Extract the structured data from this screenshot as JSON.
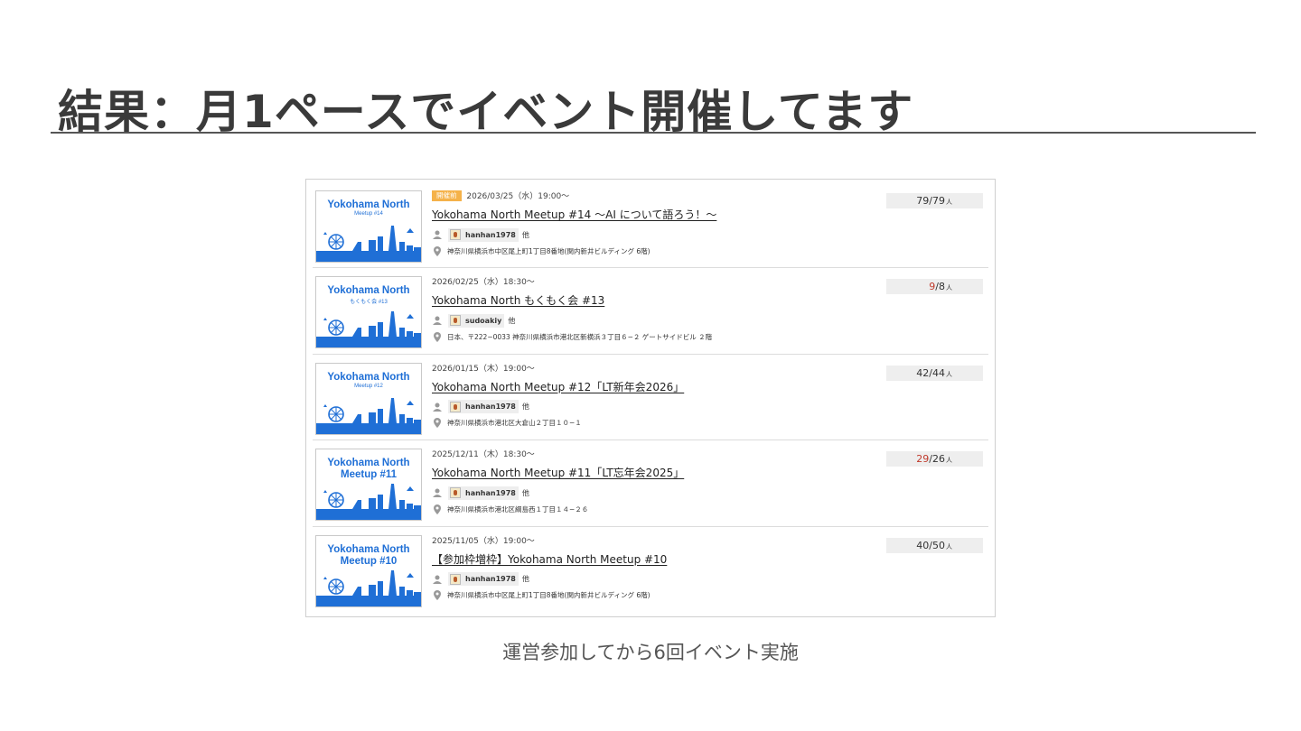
{
  "slide": {
    "title": "結果：月1ペースでイベント開催してます",
    "caption": "運営参加してから6回イベント実施"
  },
  "colors": {
    "brand_blue": "#1f6fd6",
    "badge": "#f5b24a",
    "over_capacity": "#c0392b"
  },
  "events": [
    {
      "thumb_title": "Yokohama North",
      "thumb_sub": "Meetup #14",
      "badge": "開催前",
      "date": "2026/03/25（水）19:00〜",
      "title": "Yokohama North Meetup #14 〜AI について語ろう！〜",
      "owner": "hanhan1978",
      "owner_suffix": "他",
      "place": "神奈川県横浜市中区尾上町1丁目8番地(関内新井ビルディング 6階)",
      "count_main": "79",
      "count_rest": "/79",
      "count_unit": "人",
      "over": false
    },
    {
      "thumb_title": "Yokohama North",
      "thumb_sub": "もくもく会 #13",
      "badge": "",
      "date": "2026/02/25（水）18:30〜",
      "title": "Yokohama North もくもく会 #13",
      "owner": "sudoakiy",
      "owner_suffix": "他",
      "place": "日本、〒222−0033 神奈川県横浜市港北区新横浜３丁目６−２ ゲートサイドビル ２階",
      "count_main": "9",
      "count_rest": "/8",
      "count_unit": "人",
      "over": true
    },
    {
      "thumb_title": "Yokohama North",
      "thumb_sub": "Meetup #12",
      "badge": "",
      "date": "2026/01/15（木）19:00〜",
      "title": "Yokohama North Meetup #12「LT新年会2026」",
      "owner": "hanhan1978",
      "owner_suffix": "他",
      "place": "神奈川県横浜市港北区大倉山２丁目１０−１",
      "count_main": "42",
      "count_rest": "/44",
      "count_unit": "人",
      "over": false
    },
    {
      "thumb_title": "Yokohama North",
      "thumb_sub": "Meetup #11",
      "badge": "",
      "date": "2025/12/11（木）18:30〜",
      "title": "Yokohama North Meetup #11「LT忘年会2025」",
      "owner": "hanhan1978",
      "owner_suffix": "他",
      "place": "神奈川県横浜市港北区綱島西１丁目１４−２６",
      "count_main": "29",
      "count_rest": "/26",
      "count_unit": "人",
      "over": true
    },
    {
      "thumb_title": "Yokohama North",
      "thumb_sub": "Meetup #10",
      "badge": "",
      "date": "2025/11/05（水）19:00〜",
      "title": "【参加枠増枠】Yokohama North Meetup #10",
      "owner": "hanhan1978",
      "owner_suffix": "他",
      "place": "神奈川県横浜市中区尾上町1丁目8番地(関内新井ビルディング 6階)",
      "count_main": "40",
      "count_rest": "/50",
      "count_unit": "人",
      "over": false
    }
  ]
}
